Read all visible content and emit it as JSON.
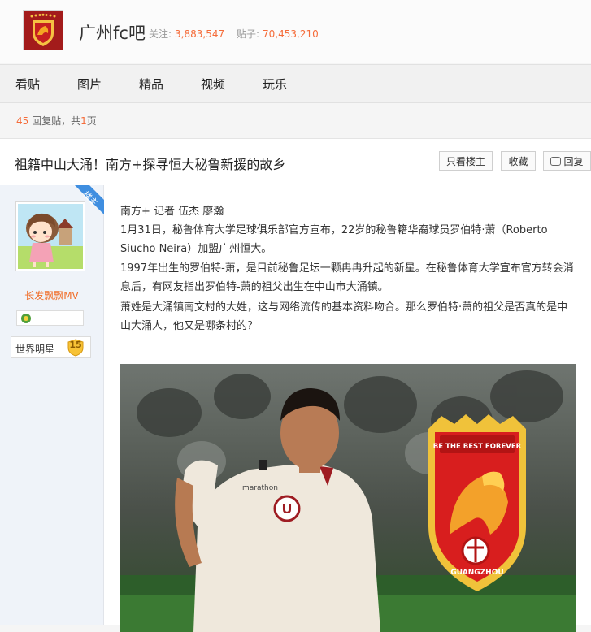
{
  "forum": {
    "name": "广州fc吧",
    "follow_label": "关注:",
    "follow_count": "3,883,547",
    "posts_label": "贴子:",
    "posts_count": "70,453,210"
  },
  "nav": {
    "items": [
      "看贴",
      "图片",
      "精品",
      "视频",
      "玩乐"
    ]
  },
  "reply_info": {
    "count": "45",
    "mid": " 回复贴，共",
    "pages": "1",
    "tail": "页"
  },
  "thread": {
    "title": "祖籍中山大涌！南方+探寻恒大秘鲁新援的故乡",
    "buttons": {
      "op_only": "只看楼主",
      "favorite": "收藏",
      "reply": "回复"
    }
  },
  "author": {
    "badge": "楼主",
    "username": "长发飘飘MV",
    "level_title": "世界明星",
    "level": "15"
  },
  "post": {
    "paragraphs": [
      "南方+ 记者 伍杰 廖瀚",
      "1月31日，秘鲁体育大学足球俱乐部官方宣布，22岁的秘鲁籍华裔球员罗伯特·萧（Roberto Siucho Neira）加盟广州恒大。",
      "1997年出生的罗伯特-萧，是目前秘鲁足坛一颗冉冉升起的新星。在秘鲁体育大学宣布官方转会消息后，有网友指出罗伯特-萧的祖父出生在中山市大涌镇。",
      "萧姓是大涌镇南文村的大姓，这与网络流传的基本资料吻合。那么罗伯特·萧的祖父是否真的是中山大涌人，他又是哪条村的？"
    ],
    "photo": {
      "crest_text": "BE THE BEST FOREVER",
      "crest_city": "GUANGZHOU",
      "jersey_sponsor": "marathon",
      "jersey_letter": "U"
    }
  },
  "colors": {
    "accent": "#f56c3a",
    "username": "#f06e2a",
    "badge": "#3f8ee0"
  }
}
